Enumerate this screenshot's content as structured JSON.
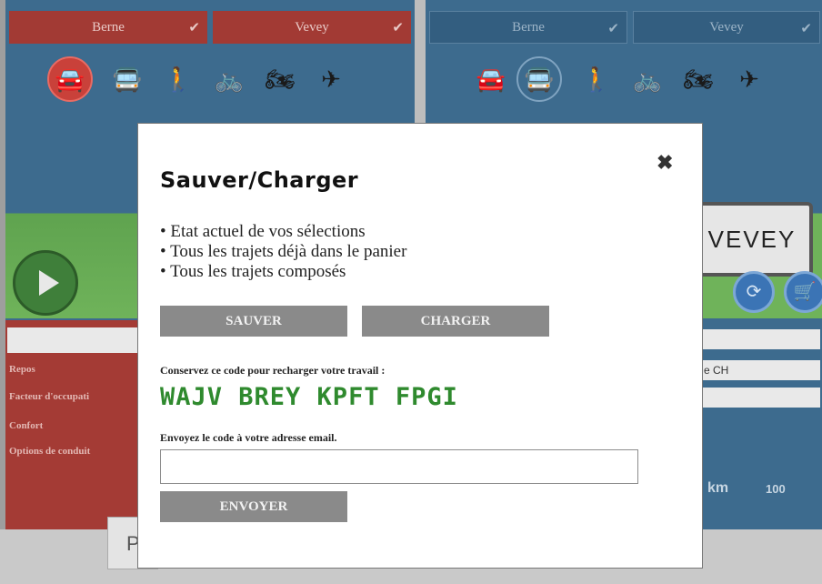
{
  "left": {
    "from": "Berne",
    "to": "Vevey",
    "voiture": "Voitu",
    "labels": [
      "Repos",
      "Facteur d'occupati",
      "Confort",
      "Options de conduit"
    ]
  },
  "right": {
    "from": "Berne",
    "to": "Vevey",
    "sign": "VEVEY",
    "select2": "e CH",
    "km": "km",
    "pct": "100"
  },
  "bottom_tab": "P",
  "modal": {
    "title": "Sauver/Charger",
    "bullets": [
      "Etat actuel de vos sélections",
      "Tous les trajets déjà dans le panier",
      "Tous les trajets composés"
    ],
    "save_label": "SAUVER",
    "load_label": "CHARGER",
    "code_note": "Conservez ce code pour recharger votre travail :",
    "code": "WAJV BREY KPFT FPGI",
    "email_note": "Envoyez le code à votre adresse email.",
    "email_value": "",
    "send_label": "ENVOYER"
  },
  "colors": {
    "accent_red": "#a23a34",
    "panel_blue": "#3d6b8e",
    "code_green": "#2f8a2e"
  },
  "icons": [
    "car-icon",
    "bus-icon",
    "walk-icon",
    "bike-icon",
    "motorbike-icon",
    "plane-icon",
    "close-icon",
    "play-icon"
  ]
}
